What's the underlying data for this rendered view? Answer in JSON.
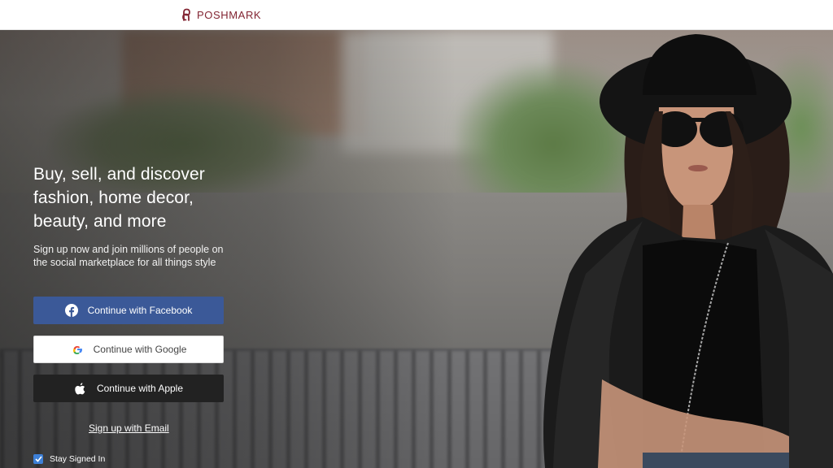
{
  "header": {
    "brand": "POSHMARK",
    "brand_color": "#822432"
  },
  "hero": {
    "headline": "Buy, sell, and discover fashion, home decor, beauty, and more",
    "subtext": "Sign up now and join millions of people on the social marketplace for all things style"
  },
  "auth": {
    "facebook_label": "Continue with Facebook",
    "google_label": "Continue with Google",
    "apple_label": "Continue with Apple",
    "email_link": "Sign up with Email",
    "stay_signed_in": "Stay Signed In",
    "stay_signed_in_checked": true
  },
  "colors": {
    "facebook": "#3b5998",
    "apple": "#222222",
    "google_bg": "#ffffff",
    "checkbox": "#3d7fd6"
  },
  "icons": {
    "brand": "poshmark-logo-icon",
    "facebook": "facebook-icon",
    "google": "google-icon",
    "apple": "apple-icon",
    "check": "check-icon"
  }
}
